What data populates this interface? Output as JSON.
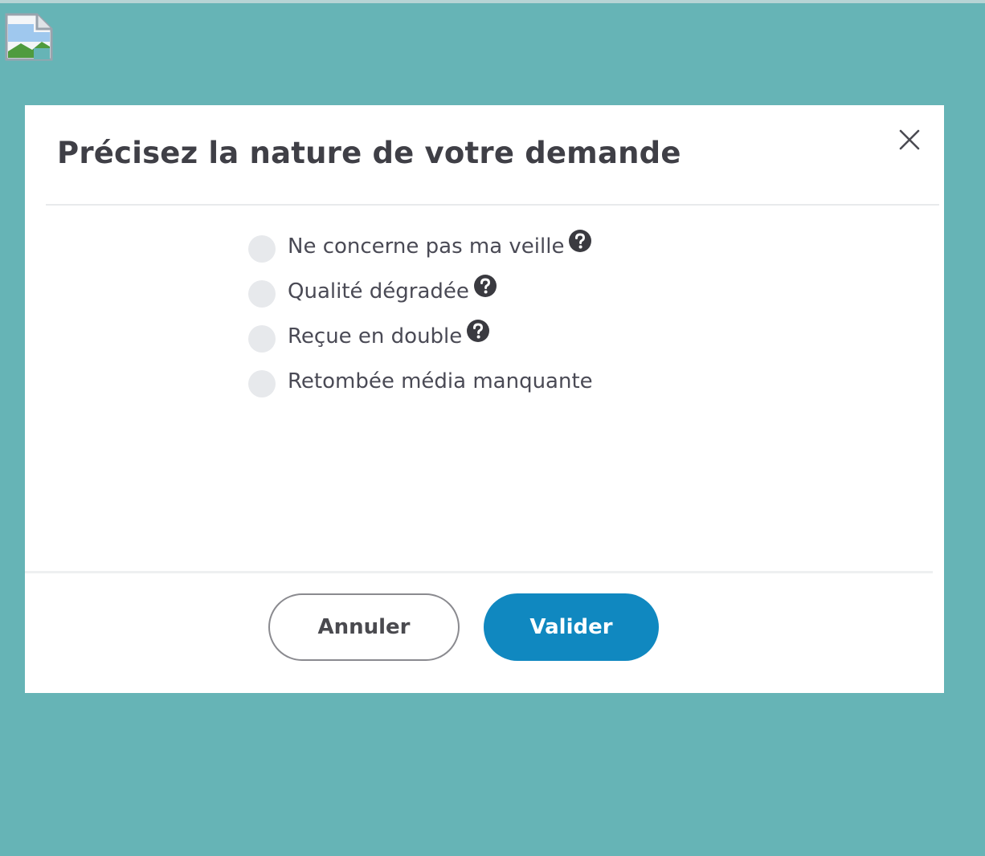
{
  "icons": {
    "broken_image": "broken-image-icon",
    "close": "close-icon",
    "help": "help-icon"
  },
  "colors": {
    "backdrop": "#66b4b6",
    "primary_button": "#1088c0"
  },
  "modal": {
    "title": "Précisez la nature de votre demande",
    "options": [
      {
        "label": "Ne concerne pas ma veille",
        "has_help": true,
        "selected": false
      },
      {
        "label": "Qualité dégradée",
        "has_help": true,
        "selected": false
      },
      {
        "label": "Reçue en double",
        "has_help": true,
        "selected": false
      },
      {
        "label": "Retombée média manquante",
        "has_help": false,
        "selected": false
      }
    ],
    "cancel_label": "Annuler",
    "validate_label": "Valider"
  }
}
